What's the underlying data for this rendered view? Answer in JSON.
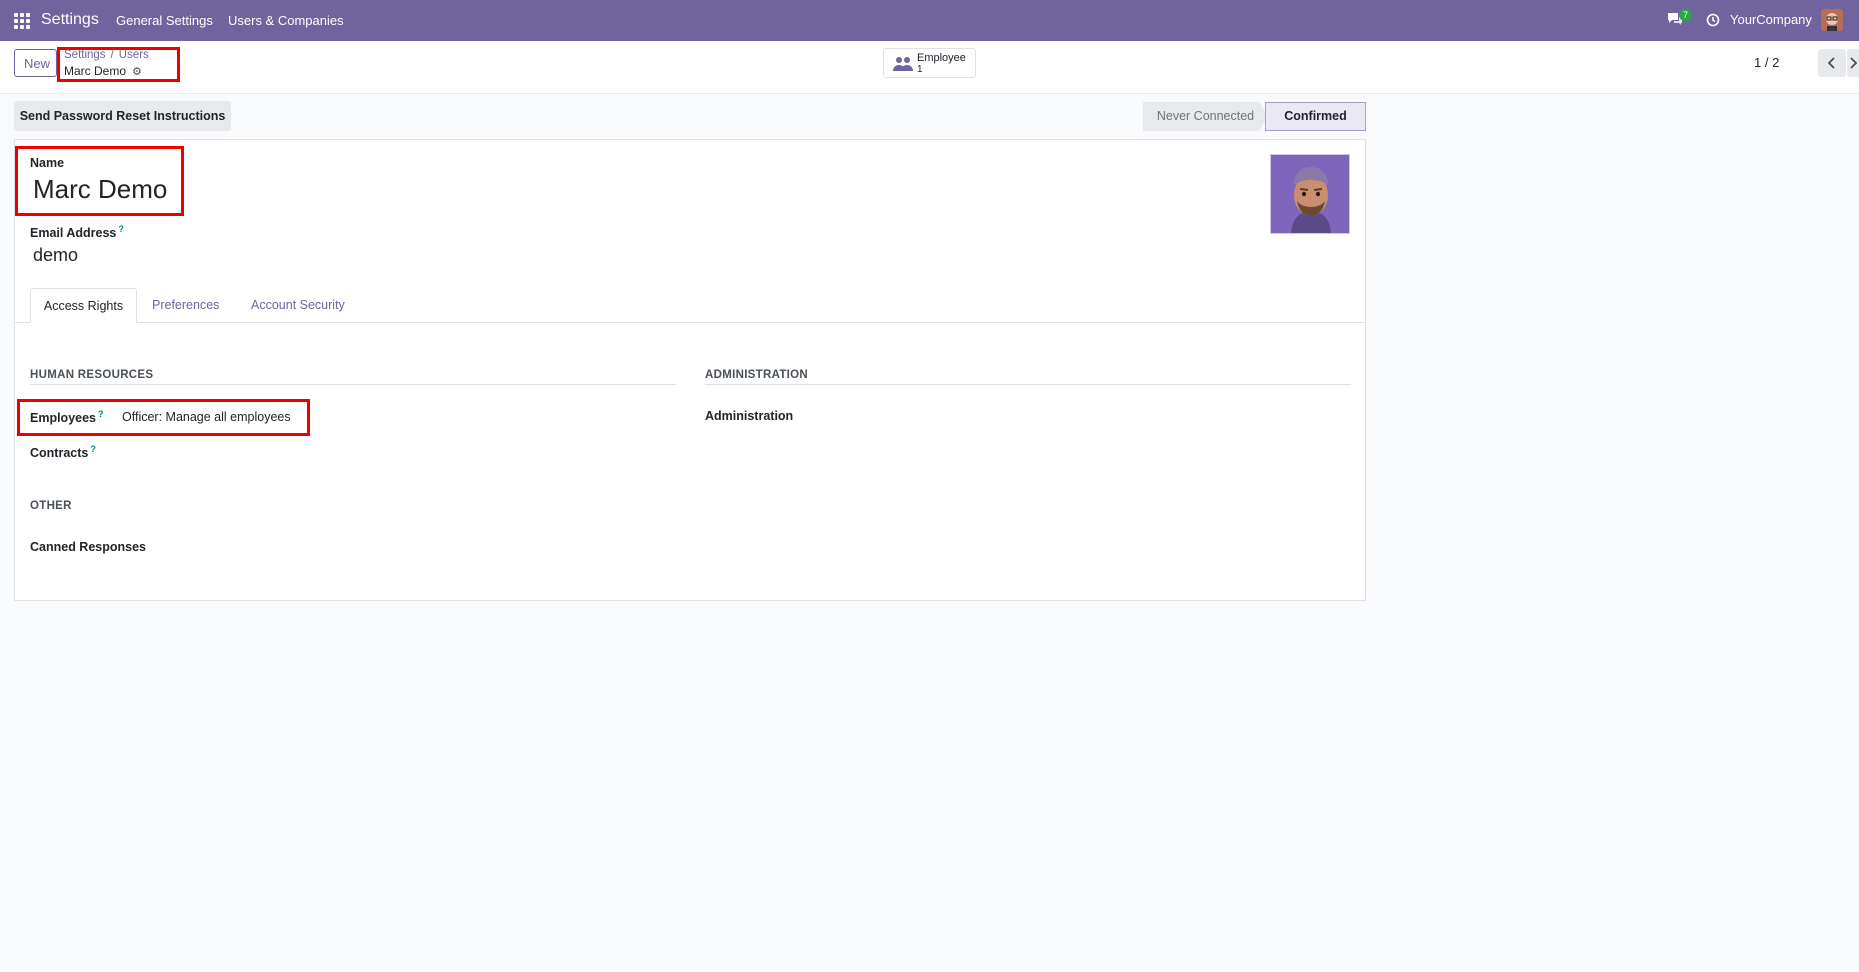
{
  "navbar": {
    "app_title": "Settings",
    "menu": [
      "General Settings",
      "Users & Companies"
    ],
    "chat_badge": "7",
    "company": "YourCompany",
    "bg_color": "#71639e"
  },
  "control": {
    "new_label": "New",
    "breadcrumb": [
      "Settings",
      "Users"
    ],
    "record_name": "Marc Demo",
    "smart_button": {
      "label": "Employee",
      "count": "1"
    },
    "pager": "1 / 2"
  },
  "actions": {
    "reset_label": "Send Password Reset Instructions",
    "status": [
      "Never Connected",
      "Confirmed"
    ]
  },
  "form": {
    "name_label": "Name",
    "name_value": "Marc Demo",
    "email_label": "Email Address",
    "email_value": "demo",
    "help_mark": "?",
    "tabs": [
      "Access Rights",
      "Preferences",
      "Account Security"
    ],
    "sections": {
      "hr_title": "HUMAN RESOURCES",
      "admin_title": "ADMINISTRATION",
      "other_title": "OTHER"
    },
    "fields": {
      "employees_label": "Employees",
      "employees_value": "Officer: Manage all employees",
      "contracts_label": "Contracts",
      "administration_label": "Administration",
      "canned_label": "Canned Responses"
    }
  }
}
